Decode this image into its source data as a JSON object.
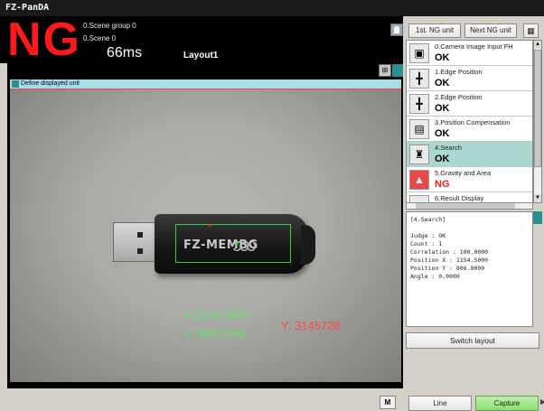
{
  "app": {
    "title": "FZ-PanDA"
  },
  "status": {
    "judgement": "NG",
    "scene_group": "0.Scene group 0",
    "scene": "0.Scene 0",
    "time": "66ms",
    "layout": "Layout1"
  },
  "image_panel": {
    "unit_bar_label": "Define displayed unit",
    "usb_logo_text": "FZ-MEMBG",
    "usb_logo_loops": "ↄↄↄ",
    "measure_x": "X:1154.5000",
    "measure_y": "Y:  806.0000",
    "measure_y_val": "Y: 3145728",
    "marker_cross": "+",
    "marker_center": "✕"
  },
  "toolbar": {
    "first_ng": "1st. NG unit",
    "next_ng": "Next NG unit",
    "calendar_icon": "▦",
    "m_label": "M",
    "image_tool_icon": "⊞"
  },
  "units": [
    {
      "label": "0.Camera Image Input FH",
      "result": "OK",
      "status": "ok",
      "icon": "▣"
    },
    {
      "label": "1.Edge Position",
      "result": "OK",
      "status": "ok",
      "icon": "╋"
    },
    {
      "label": "2.Edge Position",
      "result": "OK",
      "status": "ok",
      "icon": "╋"
    },
    {
      "label": "3.Position Compensation",
      "result": "OK",
      "status": "ok",
      "icon": "▤"
    },
    {
      "label": "4.Search",
      "result": "OK",
      "status": "ok",
      "icon": "♜"
    },
    {
      "label": "5.Gravity and Area",
      "result": "NG",
      "status": "ng",
      "icon": "▲"
    },
    {
      "label": "6.Result Display",
      "result": "",
      "status": "ok",
      "icon": "▬"
    }
  ],
  "detail": {
    "lines": [
      "[4.Search]",
      "",
      "Judge : OK",
      "Count : 1",
      "Correlation : 100.0000",
      "Position X : 1154.5000",
      "Position Y : 806.0000",
      "Angle : 0.0000"
    ]
  },
  "buttons": {
    "switch_layout": "Switch layout",
    "line": "Line",
    "capture": "Capture",
    "scroll_up": "▲",
    "scroll_down": "▼",
    "scroll_right": "►"
  }
}
